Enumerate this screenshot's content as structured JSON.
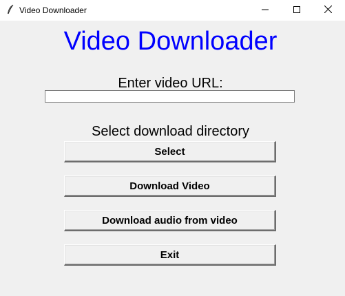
{
  "window": {
    "title": "Video Downloader",
    "icon": "feather-icon",
    "controls": {
      "minimize": "minimize-icon",
      "maximize": "maximize-icon",
      "close": "close-icon"
    }
  },
  "main": {
    "heading": "Video Downloader",
    "heading_color": "#0000ff",
    "url_label": "Enter video URL:",
    "url_value": "",
    "directory_label": "Select download directory",
    "buttons": {
      "select": "Select",
      "download_video": "Download Video",
      "download_audio": "Download audio from video",
      "exit": "Exit"
    }
  }
}
